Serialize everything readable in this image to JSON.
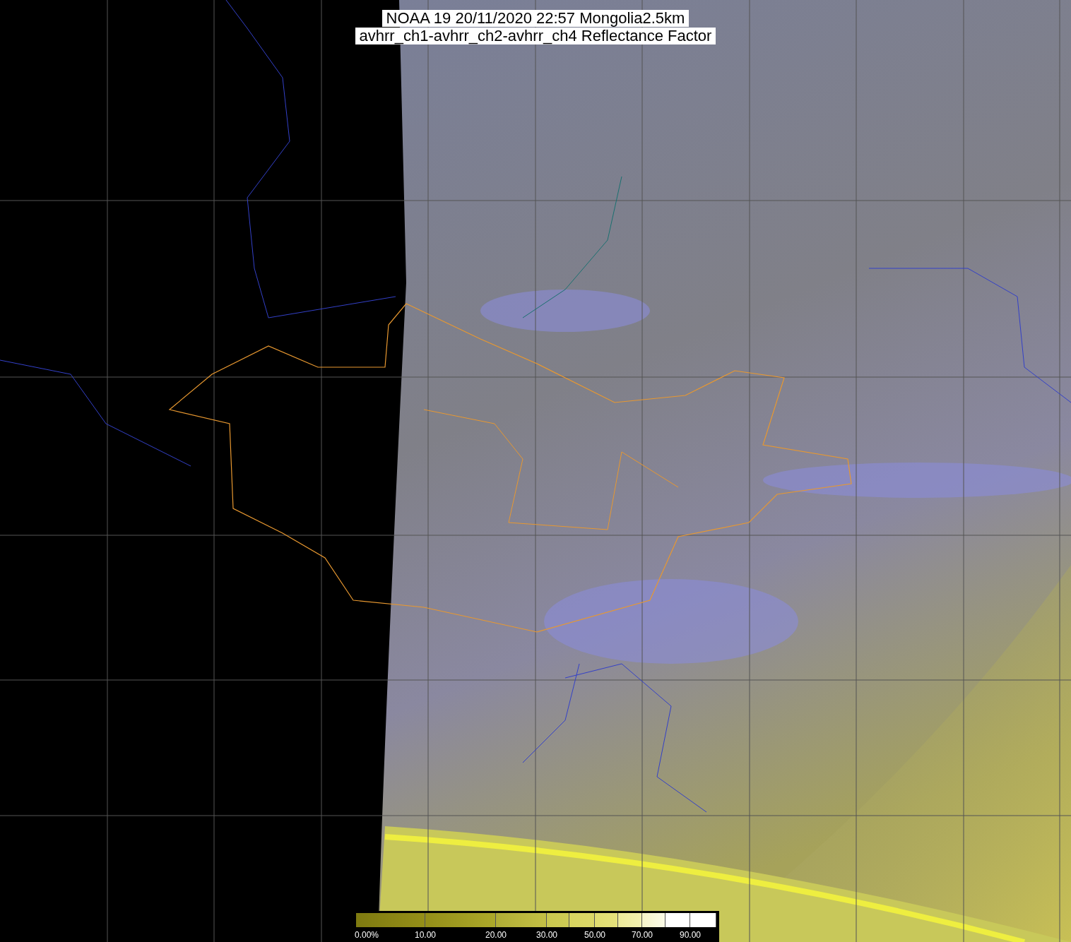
{
  "title": {
    "lines": [
      "NOAA 19 20/11/2020 22:57 Mongolia2.5km",
      "avhrr_ch1-avhrr_ch2-avhrr_ch4 Reflectance Factor"
    ]
  },
  "colorbar": {
    "labels": [
      "0.00%",
      "10.00",
      "20.00",
      "30.00",
      "50.00",
      "70.00",
      "90.00"
    ]
  }
}
